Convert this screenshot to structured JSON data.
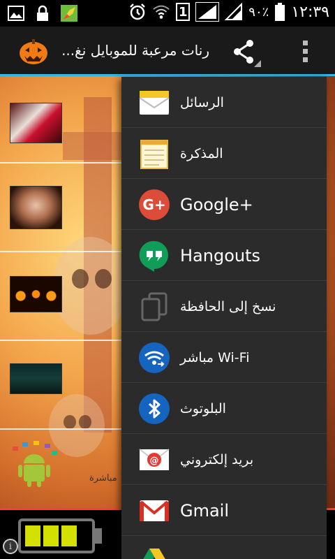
{
  "status_bar": {
    "sim_slot": "1",
    "battery_percent": "٩٠٪",
    "clock": "١٢:٣٩",
    "icons": [
      "image-icon",
      "lock-icon",
      "app-icon",
      "alarm-icon",
      "wifi-icon",
      "signal-icon",
      "signal-icon",
      "battery-icon"
    ]
  },
  "action_bar": {
    "title": "رنات مرعبة للموبايل نغ...",
    "icons": [
      "pumpkin-icon",
      "share-icon",
      "overflow-menu-icon"
    ],
    "accent_color": "#33b5e5"
  },
  "background": {
    "live_text": "مباشرة"
  },
  "share_menu": {
    "items": [
      {
        "label": "الرسائل",
        "icon": "messages-icon"
      },
      {
        "label": "المذكرة",
        "icon": "memo-icon"
      },
      {
        "label": "Google+",
        "icon": "google-plus-icon",
        "color": "#dd4b39"
      },
      {
        "label": "Hangouts",
        "icon": "hangouts-icon",
        "color": "#0f9d58"
      },
      {
        "label": "نسخ إلى الحافظة",
        "icon": "copy-icon"
      },
      {
        "label": "مباشر Wi-Fi",
        "icon": "wifi-direct-icon",
        "color": "#1565c0"
      },
      {
        "label": "البلوتوث",
        "icon": "bluetooth-icon",
        "color": "#1565c0"
      },
      {
        "label": "بريد إلكتروني",
        "icon": "email-icon",
        "color": "#e53935"
      },
      {
        "label": "Gmail",
        "icon": "gmail-icon",
        "color": "#d93025"
      },
      {
        "label": "",
        "icon": "drive-icon"
      }
    ]
  }
}
